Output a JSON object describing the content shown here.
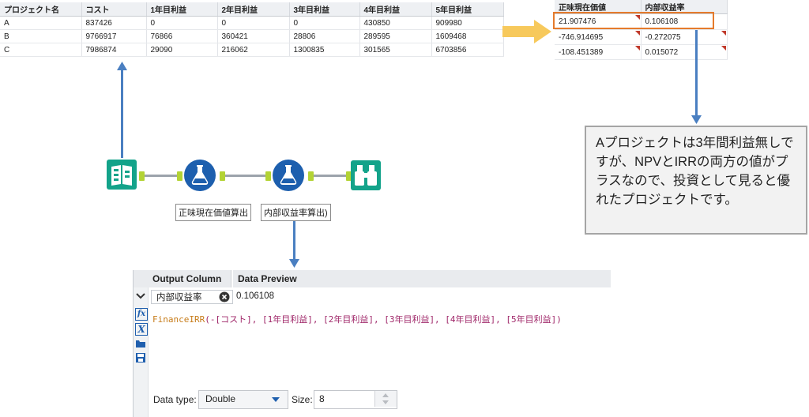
{
  "input_table": {
    "headers": [
      "プロジェクト名",
      "コスト",
      "1年目利益",
      "2年目利益",
      "3年目利益",
      "4年目利益",
      "5年目利益"
    ],
    "rows": [
      [
        "A",
        "837426",
        "0",
        "0",
        "0",
        "430850",
        "909980"
      ],
      [
        "B",
        "9766917",
        "76866",
        "360421",
        "28806",
        "289595",
        "1609468"
      ],
      [
        "C",
        "7986874",
        "29090",
        "216062",
        "1300835",
        "301565",
        "6703856"
      ]
    ]
  },
  "output_table": {
    "headers": [
      "正味現在価値",
      "内部収益率"
    ],
    "rows": [
      [
        "21.907476",
        "0.106108"
      ],
      [
        "-746.914695",
        "-0.272075"
      ],
      [
        "-108.451389",
        "0.015072"
      ]
    ]
  },
  "workflow": {
    "tool1_label": "正味現在価値算出",
    "tool2_label": "内部収益率算出)"
  },
  "callout": {
    "text": "Aプロジェクトは3年間利益無しですが、NPVとIRRの両方の値がプラスなので、投資として見ると優れたプロジェクトです。"
  },
  "panel": {
    "col_output": "Output Column",
    "col_preview": "Data Preview",
    "field_name": "内部収益率",
    "preview_value": "0.106108",
    "formula_fn": "FinanceIRR",
    "formula_args": "(-[コスト], [1年目利益], [2年目利益], [3年目利益], [4年目利益], [5年目利益])",
    "datatype_label": "Data type:",
    "datatype_value": "Double",
    "size_label": "Size:",
    "size_value": "8"
  },
  "colors": {
    "arrow_blue": "#4a7fc1",
    "highlight_orange": "#e57b2c",
    "yellow_arrow": "#f7c95c",
    "connector_green": "#b3d334",
    "tool_teal": "#13a38a",
    "tool_blue": "#1d5fae"
  },
  "icons": [
    "input-data-icon",
    "formula-icon",
    "formula-icon",
    "browse-icon"
  ]
}
